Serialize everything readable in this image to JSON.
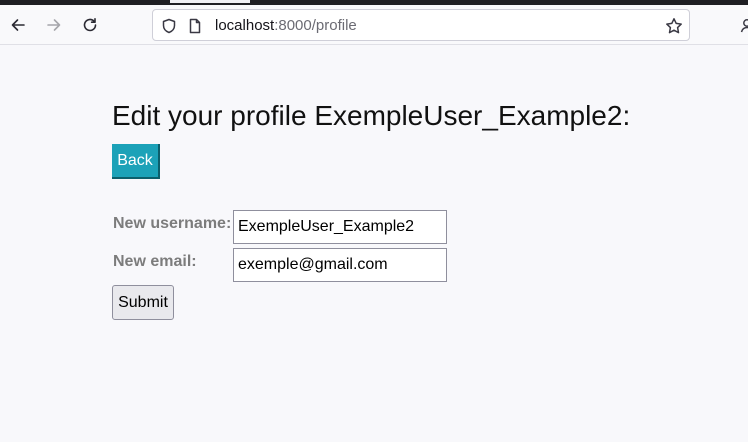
{
  "browser": {
    "url_host": "localhost",
    "url_path": ":8000/profile",
    "icons": {
      "back": "back-arrow-icon",
      "forward": "forward-arrow-icon",
      "reload": "reload-icon",
      "shield": "shield-icon",
      "page": "page-icon",
      "bookmark": "star-icon"
    }
  },
  "page": {
    "title": "Edit your profile ExempleUser_Example2:",
    "back_label": "Back",
    "form": {
      "username_label": "New username:",
      "username_value": "ExempleUser_Example2",
      "email_label": "New email:",
      "email_value": "exemple@gmail.com",
      "submit_label": "Submit"
    }
  },
  "colors": {
    "back_button": "#1ca2b8",
    "label_gray": "#7c7c7c",
    "page_background": "#f8f8fb"
  }
}
